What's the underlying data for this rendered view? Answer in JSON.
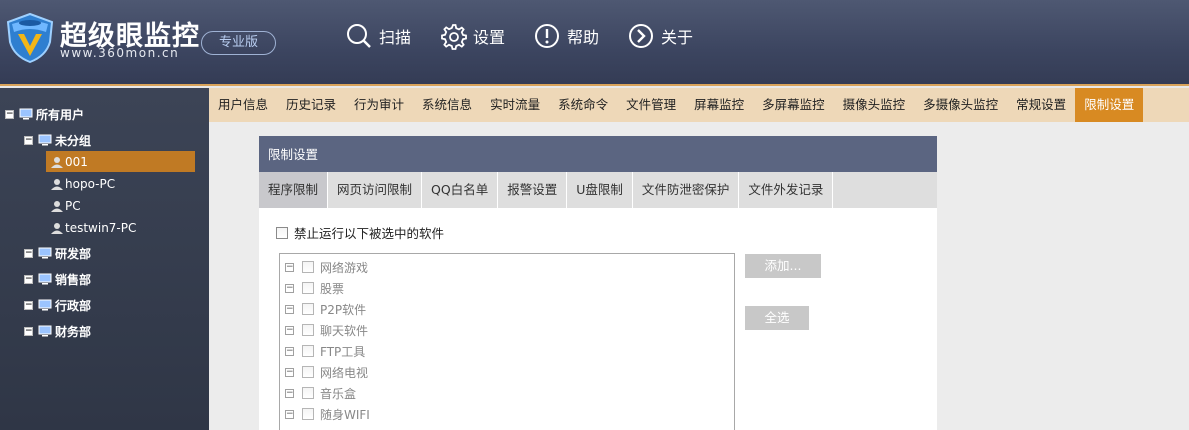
{
  "header": {
    "brand_title": "超级眼监控",
    "brand_url": "www.360mon.cn",
    "edition_badge": "专业版",
    "nav": [
      {
        "label": "扫描",
        "icon": "search-icon"
      },
      {
        "label": "设置",
        "icon": "gear-icon"
      },
      {
        "label": "帮助",
        "icon": "help-icon"
      },
      {
        "label": "关于",
        "icon": "chevron-right-icon"
      }
    ]
  },
  "sidebar": {
    "root": "所有用户",
    "groups": [
      {
        "label": "未分组",
        "users": [
          "001",
          "hopo-PC",
          "PC",
          "testwin7-PC"
        ]
      },
      {
        "label": "研发部"
      },
      {
        "label": "销售部"
      },
      {
        "label": "行政部"
      },
      {
        "label": "财务部"
      }
    ],
    "selected_user": "001"
  },
  "tabs": [
    "用户信息",
    "历史记录",
    "行为审计",
    "系统信息",
    "实时流量",
    "系统命令",
    "文件管理",
    "屏幕监控",
    "多屏幕监控",
    "摄像头监控",
    "多摄像头监控",
    "常规设置",
    "限制设置"
  ],
  "active_tab": "限制设置",
  "panel": {
    "title": "限制设置",
    "subtabs": [
      "程序限制",
      "网页访问限制",
      "QQ白名单",
      "报警设置",
      "U盘限制",
      "文件防泄密保护",
      "文件外发记录"
    ],
    "active_subtab": "程序限制",
    "block_checkbox_label": "禁止运行以下被选中的软件",
    "categories": [
      "网络游戏",
      "股票",
      "P2P软件",
      "聊天软件",
      "FTP工具",
      "网络电视",
      "音乐盒",
      "随身WIFI"
    ],
    "add_button": "添加...",
    "select_all_button": "全选"
  },
  "colors": {
    "accent": "#d88a22",
    "header_bg": "#3c4560",
    "sidebar_bg": "#343b4d",
    "tabbar_bg": "#eed8b8",
    "panel_title_bg": "#5b6581"
  }
}
